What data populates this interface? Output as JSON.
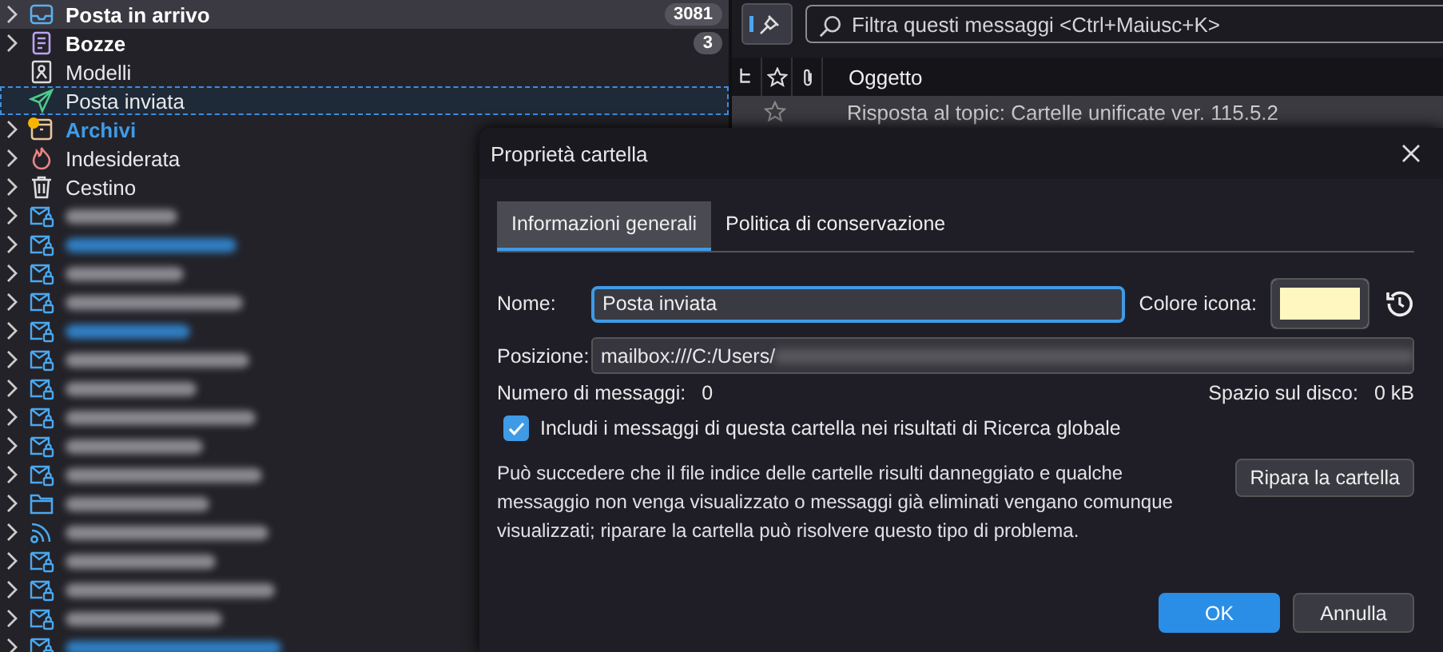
{
  "folders": [
    {
      "kind": "inbox",
      "label": "Posta in arrivo",
      "bold": true,
      "count": "3081",
      "selected": true,
      "focused": false,
      "expandable": true
    },
    {
      "kind": "drafts",
      "label": "Bozze",
      "bold": true,
      "count": "3",
      "selected": false,
      "focused": false,
      "expandable": true
    },
    {
      "kind": "templates",
      "label": "Modelli",
      "bold": false,
      "selected": false,
      "focused": false,
      "expandable": false
    },
    {
      "kind": "sent",
      "label": "Posta inviata",
      "bold": false,
      "selected": false,
      "focused": true,
      "expandable": false
    },
    {
      "kind": "archive",
      "label": "Archivi",
      "bold": true,
      "new": true,
      "selected": false,
      "focused": false,
      "expandable": true
    },
    {
      "kind": "junk",
      "label": "Indesiderata",
      "bold": false,
      "selected": false,
      "focused": false,
      "expandable": true
    },
    {
      "kind": "trash",
      "label": "Cestino",
      "bold": false,
      "selected": false,
      "focused": false,
      "expandable": true
    }
  ],
  "accounts": [
    {
      "kind": "account",
      "new": false
    },
    {
      "kind": "account",
      "new": true
    },
    {
      "kind": "account",
      "new": false
    },
    {
      "kind": "account",
      "new": false
    },
    {
      "kind": "account",
      "new": true
    },
    {
      "kind": "account",
      "new": false
    },
    {
      "kind": "account",
      "new": false
    },
    {
      "kind": "account",
      "new": false
    },
    {
      "kind": "account",
      "new": false
    },
    {
      "kind": "account",
      "new": false
    },
    {
      "kind": "folder",
      "new": false
    },
    {
      "kind": "feed",
      "new": false
    },
    {
      "kind": "account",
      "new": false
    },
    {
      "kind": "account",
      "new": false
    },
    {
      "kind": "account",
      "new": false
    },
    {
      "kind": "account",
      "new": true
    }
  ],
  "message_pane": {
    "search": {
      "placeholder": "Filtra questi messaggi <Ctrl+Maiusc+K>"
    },
    "columns": [
      {
        "kind": "thread"
      },
      {
        "kind": "star"
      },
      {
        "kind": "attachment"
      },
      {
        "kind": "text",
        "label": "Oggetto"
      }
    ],
    "rows": [
      {
        "subject": "Risposta al topic: Cartelle unificate ver. 115.5.2",
        "starred": false
      }
    ]
  },
  "dialog": {
    "title": "Proprietà cartella",
    "tabs": [
      {
        "label": "Informazioni generali",
        "selected": true
      },
      {
        "label": "Politica di conservazione",
        "selected": false
      }
    ],
    "name_label": "Nome:",
    "name_value": "Posta inviata",
    "icon_color_label": "Colore icona:",
    "location_label": "Posizione:",
    "location_value": "mailbox:///C:/Users/",
    "messages_label": "Numero di messaggi:",
    "messages_value": "0",
    "disk_label": "Spazio sul disco:",
    "disk_value": "0 kB",
    "include_search": {
      "label": "Includi i messaggi di questa cartella nei risultati di Ricerca globale",
      "checked": true
    },
    "repair_text": "Può succedere che il file indice delle cartelle risulti danneggiato e qualche messaggio non venga visualizzato o messaggi già eliminati vengano comunque visualizzati; riparare la cartella può risolvere questo tipo di problema.",
    "repair_button": "Ripara la cartella",
    "buttons": [
      {
        "label": "OK",
        "primary": true
      },
      {
        "label": "Annulla",
        "primary": false
      }
    ]
  }
}
